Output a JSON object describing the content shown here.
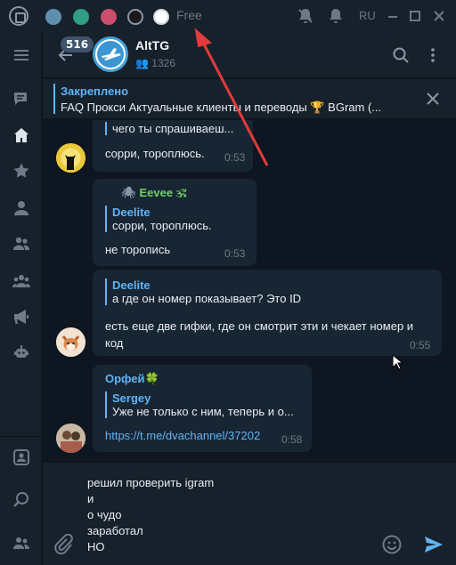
{
  "titlebar": {
    "free_label": "Free",
    "lang": "RU",
    "swatches": [
      "#5f8fb0",
      "#2e9e86",
      "#cc4d6c",
      "#1a1a1a",
      "#ffffff"
    ]
  },
  "sidebar": {
    "icons": [
      "chats-icon",
      "home-icon",
      "star-icon",
      "user-icon",
      "two-users-icon",
      "group-icon",
      "megaphone-icon",
      "robot-icon",
      "contacts-icon",
      "search-chat-icon",
      "people-icon"
    ],
    "active": "home-icon"
  },
  "header": {
    "unread_count": "516",
    "title": "AltTG",
    "members": "1326"
  },
  "pinned": {
    "title": "Закреплено",
    "text": "FAQ  Прокси  Актуальные клиенты и переводы  🏆 BGram (..."
  },
  "messages": [
    {
      "reply_text": "чего ты спрашиваеш...",
      "text": "сорри, тороплюсь.",
      "time": "0:53"
    },
    {
      "sender": "Eevee 🕉",
      "reply_name": "Deelite",
      "reply_text": "сорри, тороплюсь.",
      "text": "не торопись",
      "time": "0:53"
    },
    {
      "reply_name": "Deelite",
      "reply_text": "а где он номер показывает? Это ID",
      "text_line1": "есть еще две гифки, где он смотрит эти и чекает номер и",
      "text_line2": "код",
      "time": "0:55"
    },
    {
      "sender": "Орфей🍀",
      "reply_name": "Sergey",
      "reply_text": "Уже не только с ним, теперь и о...",
      "link": "https://t.me/dvachannel/37202",
      "time": "0:58"
    }
  ],
  "composer": {
    "text": "решил проверить igram\nи\nо чудо\nзаработал\nНО"
  },
  "colors": {
    "accent": "#5eb5f7",
    "sender_green": "#6fcf6a",
    "annotation_arrow": "#e23b3b"
  }
}
